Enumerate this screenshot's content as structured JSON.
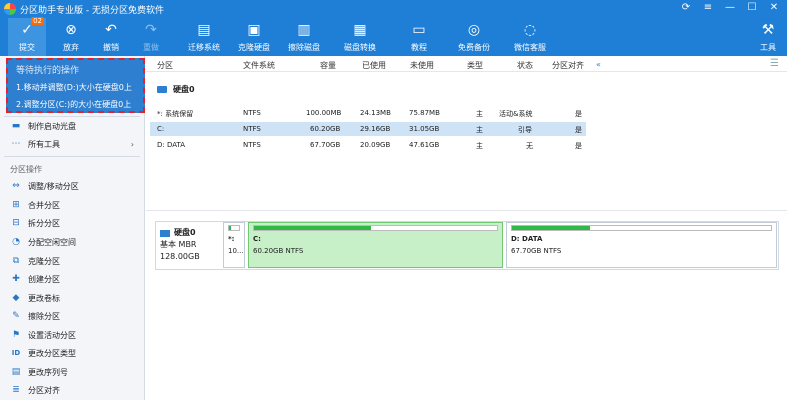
{
  "window": {
    "title": "分区助手专业版 - 无损分区免费软件"
  },
  "toolbar": {
    "items": [
      {
        "label": "提交",
        "badge": "02",
        "icon": "check-icon"
      },
      {
        "label": "放弃",
        "icon": "cancel-circle-icon"
      },
      {
        "label": "撤销",
        "icon": "undo-icon"
      },
      {
        "label": "重做",
        "icon": "redo-icon"
      },
      {
        "label": "迁移系统",
        "icon": "migrate-os-icon"
      },
      {
        "label": "克隆硬盘",
        "icon": "clone-disk-icon"
      },
      {
        "label": "擦除磁盘",
        "icon": "wipe-disk-icon"
      },
      {
        "label": "磁盘转换",
        "icon": "convert-disk-icon"
      },
      {
        "label": "教程",
        "icon": "tutorial-icon"
      },
      {
        "label": "免费备份",
        "icon": "backup-icon"
      },
      {
        "label": "微信客服",
        "icon": "wechat-icon"
      },
      {
        "label": "工具",
        "icon": "tools-icon"
      }
    ]
  },
  "pending": {
    "header": "等待执行的操作",
    "items": [
      "1.移动并调整(D:)大小在硬盘0上",
      "2.调整分区(C:)的大小在硬盘0上"
    ]
  },
  "left": {
    "top_items": [
      {
        "label": "制作启动光盘",
        "icon": "boot-disc-icon"
      },
      {
        "label": "所有工具",
        "icon": "all-tools-icon"
      }
    ],
    "section": "分区操作",
    "ops": [
      {
        "label": "调整/移动分区",
        "icon": "resize-icon"
      },
      {
        "label": "合并分区",
        "icon": "merge-icon"
      },
      {
        "label": "拆分分区",
        "icon": "split-icon"
      },
      {
        "label": "分配空闲空间",
        "icon": "allocate-icon"
      },
      {
        "label": "克隆分区",
        "icon": "clone-icon"
      },
      {
        "label": "创建分区",
        "icon": "create-icon"
      },
      {
        "label": "更改卷标",
        "icon": "label-icon"
      },
      {
        "label": "擦除分区",
        "icon": "wipe-icon"
      },
      {
        "label": "设置活动分区",
        "icon": "active-icon"
      },
      {
        "label": "更改分区类型",
        "icon": "id-icon"
      },
      {
        "label": "更改序列号",
        "icon": "serial-icon"
      },
      {
        "label": "分区对齐",
        "icon": "align-icon"
      }
    ]
  },
  "table": {
    "headers": [
      "分区",
      "文件系统",
      "容量",
      "已使用",
      "未使用",
      "类型",
      "状态",
      "分区对齐"
    ],
    "disk_label": "硬盘0",
    "rows": [
      [
        "*: 系统保留",
        "NTFS",
        "100.00MB",
        "24.13MB",
        "75.87MB",
        "主",
        "活动&系统",
        "是"
      ],
      [
        "C:",
        "NTFS",
        "60.20GB",
        "29.16GB",
        "31.05GB",
        "主",
        "引导",
        "是"
      ],
      [
        "D: DATA",
        "NTFS",
        "67.70GB",
        "20.09GB",
        "47.61GB",
        "主",
        "无",
        "是"
      ]
    ]
  },
  "map": {
    "disk": {
      "name": "硬盘0",
      "type": "基本 MBR",
      "size": "128.00GB"
    },
    "parts": [
      {
        "name": "*:",
        "size": "10...",
        "used_pct": 24
      },
      {
        "name": "C:",
        "size": "60.20GB NTFS",
        "used_pct": 48
      },
      {
        "name": "D: DATA",
        "size": "67.70GB NTFS",
        "used_pct": 30
      }
    ]
  },
  "colors": {
    "accent": "#1f7fd6",
    "used": "#2fba45",
    "selected_row": "#cfe3f7",
    "pending_border": "#e2222a"
  }
}
